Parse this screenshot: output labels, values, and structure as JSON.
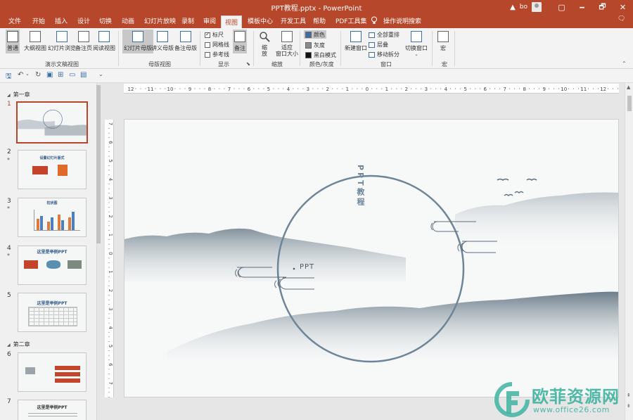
{
  "window": {
    "title": "PPT教程.pptx  -  PowerPoint",
    "warning_icon": "warning-icon",
    "user_name": "bo",
    "minimize": "🗕",
    "restore": "🗗",
    "close": "✕",
    "ribbon_display": "▢"
  },
  "tabs": [
    {
      "label": "文件"
    },
    {
      "label": "开始"
    },
    {
      "label": "插入"
    },
    {
      "label": "设计"
    },
    {
      "label": "切换"
    },
    {
      "label": "动画"
    },
    {
      "label": "幻灯片放映"
    },
    {
      "label": "录制"
    },
    {
      "label": "审阅"
    },
    {
      "label": "视图"
    },
    {
      "label": "模板中心"
    },
    {
      "label": "开发工具"
    },
    {
      "label": "帮助"
    },
    {
      "label": "PDF工具集"
    },
    {
      "label": "操作说明搜索"
    }
  ],
  "active_tab": "视图",
  "ribbon": {
    "presentation_views": {
      "group_label": "演示文稿视图",
      "buttons": [
        {
          "label": "普通"
        },
        {
          "label": "大纲视图"
        },
        {
          "label": "幻灯片浏览"
        },
        {
          "label": "备注页"
        },
        {
          "label": "阅读视图"
        }
      ]
    },
    "master_views": {
      "group_label": "母版视图",
      "buttons": [
        {
          "label": "幻灯片母版"
        },
        {
          "label": "讲义母版"
        },
        {
          "label": "备注母版"
        }
      ]
    },
    "show": {
      "group_label": "显示",
      "checkboxes": [
        {
          "label": "标尺",
          "checked": true
        },
        {
          "label": "网格线",
          "checked": false
        },
        {
          "label": "参考线",
          "checked": false
        }
      ],
      "notes_button": "备注"
    },
    "zoom": {
      "group_label": "缩放",
      "zoom_button": "缩\n放",
      "fit_line1": "适应",
      "fit_line2": "窗口大小"
    },
    "color": {
      "group_label": "颜色/灰度",
      "options": [
        {
          "label": "颜色",
          "swatch": "#3b6ea5"
        },
        {
          "label": "灰度",
          "swatch": "#8a8a8a"
        },
        {
          "label": "黑白模式",
          "swatch": "#111111"
        }
      ]
    },
    "window": {
      "group_label": "窗口",
      "new_window": "新建窗口",
      "arrange_all": "全部重排",
      "cascade": "层叠",
      "move_split": "移动拆分",
      "switch_windows": "切换窗口"
    },
    "macros": {
      "group_label": "宏",
      "button": "宏"
    }
  },
  "sidebar": {
    "sections": [
      "第一章",
      "第二章"
    ],
    "slides": [
      {
        "num": "1",
        "star": "",
        "title": ""
      },
      {
        "num": "2",
        "star": "*",
        "title": "设置幻灯片版式"
      },
      {
        "num": "3",
        "star": "*",
        "title": "柱状图"
      },
      {
        "num": "4",
        "star": "*",
        "title": "这里是举例PPT"
      },
      {
        "num": "5",
        "star": "",
        "title": "这里是举例PPT"
      },
      {
        "num": "6",
        "star": "",
        "title": ""
      },
      {
        "num": "7",
        "star": "",
        "title": "这里是举例PPT"
      }
    ]
  },
  "slide": {
    "vertical_title": "PPT教程",
    "subtitle": "PPT"
  },
  "ruler": {
    "h_labels": [
      "12",
      "11",
      "10",
      "9",
      "8",
      "7",
      "6",
      "5",
      "4",
      "3",
      "2",
      "1",
      "0",
      "1",
      "2",
      "3",
      "4",
      "5",
      "6",
      "7",
      "8",
      "9",
      "10",
      "11",
      "12"
    ],
    "v_labels": [
      "7",
      "6",
      "5",
      "4",
      "3",
      "2",
      "1",
      "0",
      "1",
      "2",
      "3",
      "4",
      "5",
      "6",
      "7"
    ]
  },
  "watermark": {
    "text": "欧菲资源网",
    "url": "www.office26.com"
  },
  "colors": {
    "accent": "#b7472a",
    "circle": "#6d8599",
    "mountain": "#7f8f9a"
  }
}
